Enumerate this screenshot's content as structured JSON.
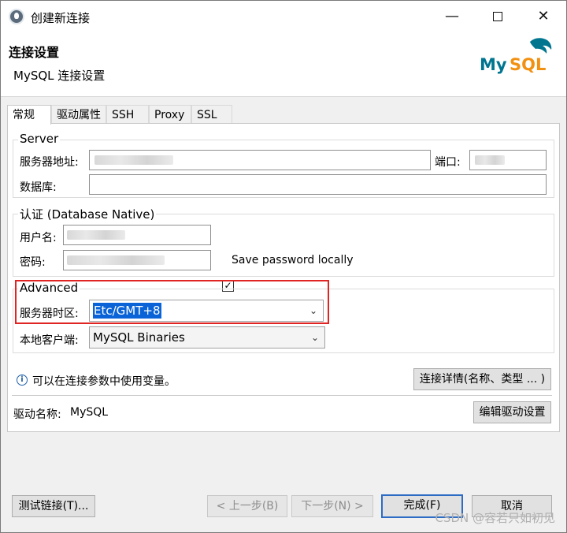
{
  "window": {
    "title": "创建新连接",
    "icon": "dbeaver-icon"
  },
  "header": {
    "title": "连接设置",
    "subtitle": "MySQL 连接设置",
    "logo": "MySQL"
  },
  "tabs": [
    {
      "label": "常规",
      "active": true
    },
    {
      "label": "驱动属性",
      "active": false
    },
    {
      "label": "SSH",
      "active": false
    },
    {
      "label": "Proxy",
      "active": false
    },
    {
      "label": "SSL",
      "active": false
    }
  ],
  "server": {
    "group_title": "Server",
    "host_label": "服务器地址:",
    "port_label": "端口:",
    "database_label": "数据库:",
    "database_value": ""
  },
  "auth": {
    "group_title": "认证 (Database Native)",
    "user_label": "用户名:",
    "password_label": "密码:",
    "save_password_label": "Save password locally",
    "save_password_checked": true
  },
  "advanced": {
    "group_title": "Advanced",
    "timezone_label": "服务器时区:",
    "timezone_value": "Etc/GMT+8",
    "client_label": "本地客户端:",
    "client_value": "MySQL Binaries"
  },
  "info": {
    "text": "可以在连接参数中使用变量。",
    "details_button": "连接详情(名称、类型 ... )"
  },
  "driver": {
    "label": "驱动名称:",
    "value": "MySQL",
    "edit_button": "编辑驱动设置"
  },
  "footer": {
    "test_button": "测试链接(T)...",
    "back_button": "< 上一步(B)",
    "next_button": "下一步(N) >",
    "finish_button": "完成(F)",
    "cancel_button": "取消"
  },
  "watermark": "CSDN @容若只如初见",
  "colors": {
    "highlight_border": "#e02424",
    "selection": "#0a64d8",
    "mysql_blue": "#00758f",
    "mysql_orange": "#f29111"
  }
}
